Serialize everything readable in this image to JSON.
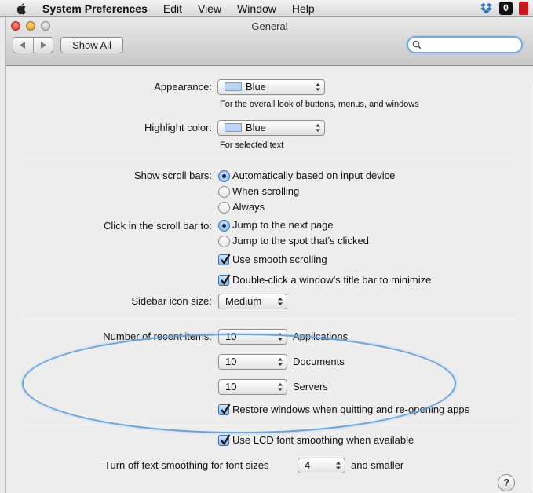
{
  "menubar": {
    "app": "System Preferences",
    "items": [
      "Edit",
      "View",
      "Window",
      "Help"
    ],
    "extras": {
      "zero": "0"
    }
  },
  "window": {
    "title": "General",
    "show_all": "Show All",
    "search_value": ""
  },
  "appearance": {
    "label": "Appearance:",
    "value": "Blue",
    "desc": "For the overall look of buttons, menus, and windows"
  },
  "highlight": {
    "label": "Highlight color:",
    "value": "Blue",
    "desc": "For selected text"
  },
  "scrollbars": {
    "label": "Show scroll bars:",
    "options": [
      "Automatically based on input device",
      "When scrolling",
      "Always"
    ],
    "selected": 0
  },
  "click_scroll": {
    "label": "Click in the scroll bar to:",
    "options": [
      "Jump to the next page",
      "Jump to the spot that’s clicked"
    ],
    "selected": 0
  },
  "checks": {
    "smooth": "Use smooth scrolling",
    "doubleclick": "Double-click a window’s title bar to minimize",
    "restore": "Restore windows when quitting and re-opening apps",
    "lcd": "Use LCD font smoothing when available"
  },
  "sidebar": {
    "label": "Sidebar icon size:",
    "value": "Medium"
  },
  "recent": {
    "label": "Number of recent items:",
    "rows": [
      {
        "value": "10",
        "kind": "Applications"
      },
      {
        "value": "10",
        "kind": "Documents"
      },
      {
        "value": "10",
        "kind": "Servers"
      }
    ]
  },
  "smoothing": {
    "label": "Turn off text smoothing for font sizes",
    "value": "4",
    "suffix": "and smaller"
  },
  "help": "?",
  "colors": {
    "accent": "#3a6fb0",
    "annotation": "#6aa1d8",
    "swatch": "#b9d4f4"
  }
}
